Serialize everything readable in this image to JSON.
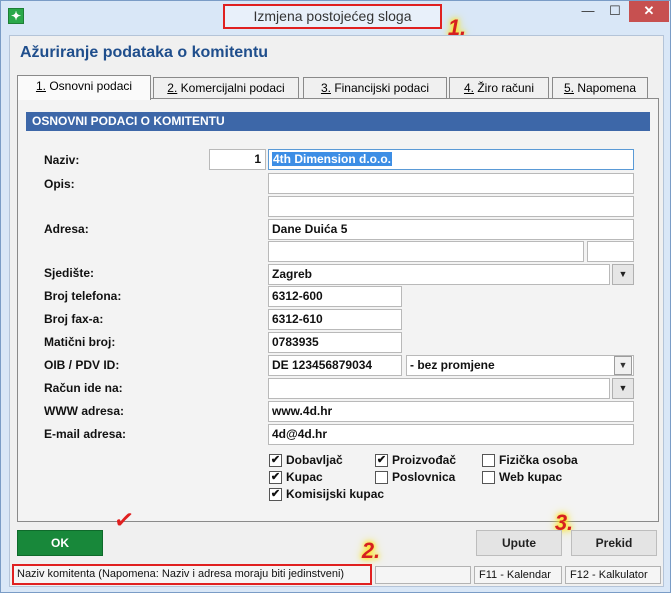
{
  "window": {
    "title": "Izmjena postojećeg sloga",
    "minimize_glyph": "—",
    "maximize_glyph": "☐",
    "close_glyph": "✕"
  },
  "annotations": {
    "m1": "1.",
    "m2": "2.",
    "m3": "3.",
    "check": "✓"
  },
  "header": {
    "title": "Ažuriranje podataka o komitentu"
  },
  "tabs": [
    {
      "num": "1.",
      "label": "Osnovni podaci",
      "active": true
    },
    {
      "num": "2.",
      "label": "Komercijalni podaci"
    },
    {
      "num": "3.",
      "label": "Financijski podaci"
    },
    {
      "num": "4.",
      "label": "Žiro računi"
    },
    {
      "num": "5.",
      "label": "Napomena"
    }
  ],
  "section": {
    "title": "OSNOVNI PODACI O KOMITENTU"
  },
  "labels": {
    "naziv": "Naziv:",
    "opis": "Opis:",
    "adresa": "Adresa:",
    "sjediste": "Sjedište:",
    "telefon": "Broj telefona:",
    "fax": "Broj fax-a:",
    "maticni": "Matični broj:",
    "oib": "OIB / PDV ID:",
    "racun": "Račun ide na:",
    "www": "WWW adresa:",
    "email": "E-mail adresa:"
  },
  "fields": {
    "sifra": "1",
    "naziv": "4th Dimension d.o.o.",
    "opis1": "",
    "opis2": "",
    "adresa": "Dane Duića 5",
    "adresa2": "",
    "adresa3": "",
    "sjediste": "Zagreb",
    "telefon": "6312-600",
    "fax": "6312-610",
    "maticni": "0783935",
    "oib": "DE 123456879034",
    "oib_status": "- bez promjene",
    "racun": "",
    "www": "www.4d.hr",
    "email": "4d@4d.hr"
  },
  "checkboxes": [
    {
      "label": "Dobavljač",
      "checked": true
    },
    {
      "label": "Proizvođač",
      "checked": true
    },
    {
      "label": "Fizička osoba",
      "checked": false
    },
    {
      "label": "Kupac",
      "checked": true
    },
    {
      "label": "Poslovnica",
      "checked": false
    },
    {
      "label": "Web kupac",
      "checked": false
    },
    {
      "label": "Komisijski kupac",
      "checked": true
    }
  ],
  "buttons": {
    "ok": "OK",
    "upute": "Upute",
    "prekid": "Prekid"
  },
  "status": {
    "message": "Naziv komitenta (Napomena: Naziv i adresa moraju biti jedinstveni)",
    "f11": "F11 - Kalendar",
    "f12": "F12 - Kalkulator"
  },
  "icons": {
    "dropdown": "▼",
    "check": "✔",
    "app": "✦"
  },
  "colors": {
    "accent": "#3d67a8",
    "ok_green": "#18883a",
    "highlight_red": "#e02020"
  }
}
